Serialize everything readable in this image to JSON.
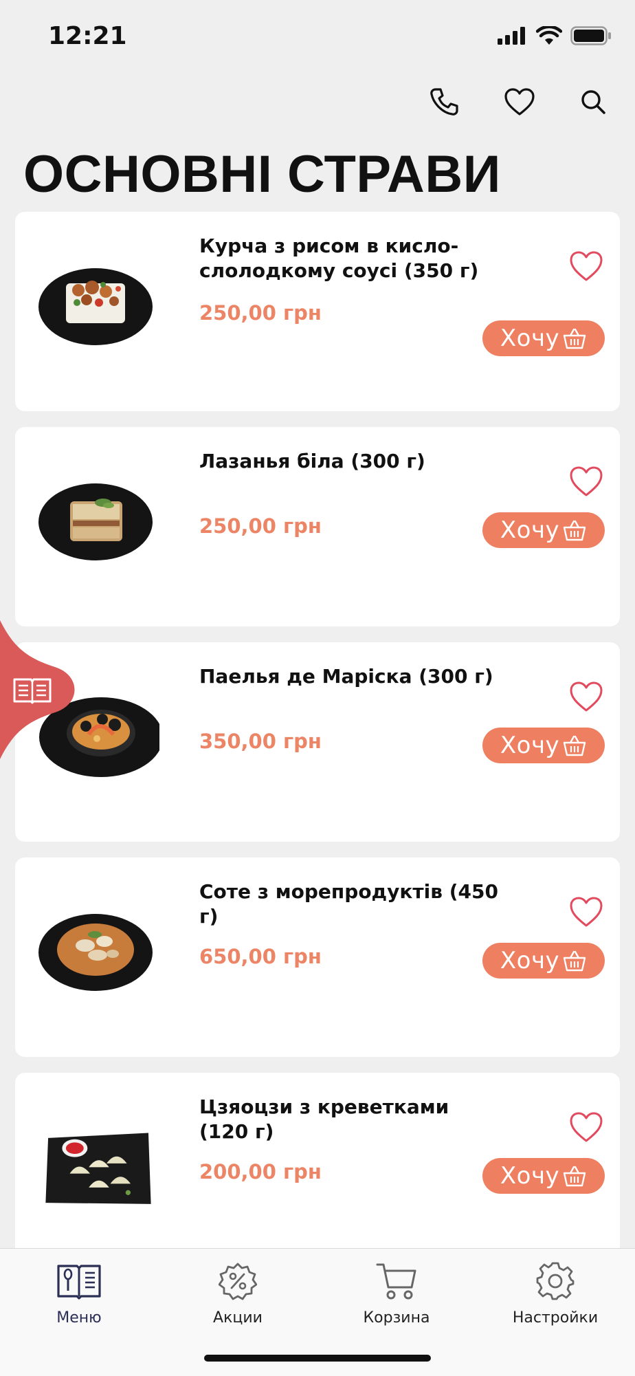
{
  "status_bar": {
    "time": "12:21"
  },
  "page": {
    "title": "ОСНОВНІ СТРАВИ"
  },
  "colors": {
    "accent": "#ef7f61",
    "price": "#ec8566",
    "heart": "#e24a5e",
    "side_tab": "#d95a58",
    "tab_active": "#2c2f55"
  },
  "header_icons": [
    "phone-icon",
    "heart-icon",
    "search-icon"
  ],
  "dishes": [
    {
      "name": "Курча з рисом в кисло-слолодкому соусі (350 г)",
      "price": "250,00 грн",
      "buy_label": "Хочу"
    },
    {
      "name": "Лазанья біла (300 г)",
      "price": "250,00 грн",
      "buy_label": "Хочу"
    },
    {
      "name": "Паелья де Маріска (300 г)",
      "price": "350,00 грн",
      "buy_label": "Хочу"
    },
    {
      "name": "Соте з морепродуктів (450 г)",
      "price": "650,00 грн",
      "buy_label": "Хочу"
    },
    {
      "name": "Цзяоцзи з креветками (120 г)",
      "price": "200,00 грн",
      "buy_label": "Хочу"
    }
  ],
  "tabbar": {
    "items": [
      {
        "label": "Меню",
        "icon": "menu-book-icon",
        "active": true
      },
      {
        "label": "Акции",
        "icon": "discount-icon",
        "active": false
      },
      {
        "label": "Корзина",
        "icon": "cart-icon",
        "active": false
      },
      {
        "label": "Настройки",
        "icon": "gear-icon",
        "active": false
      }
    ]
  }
}
